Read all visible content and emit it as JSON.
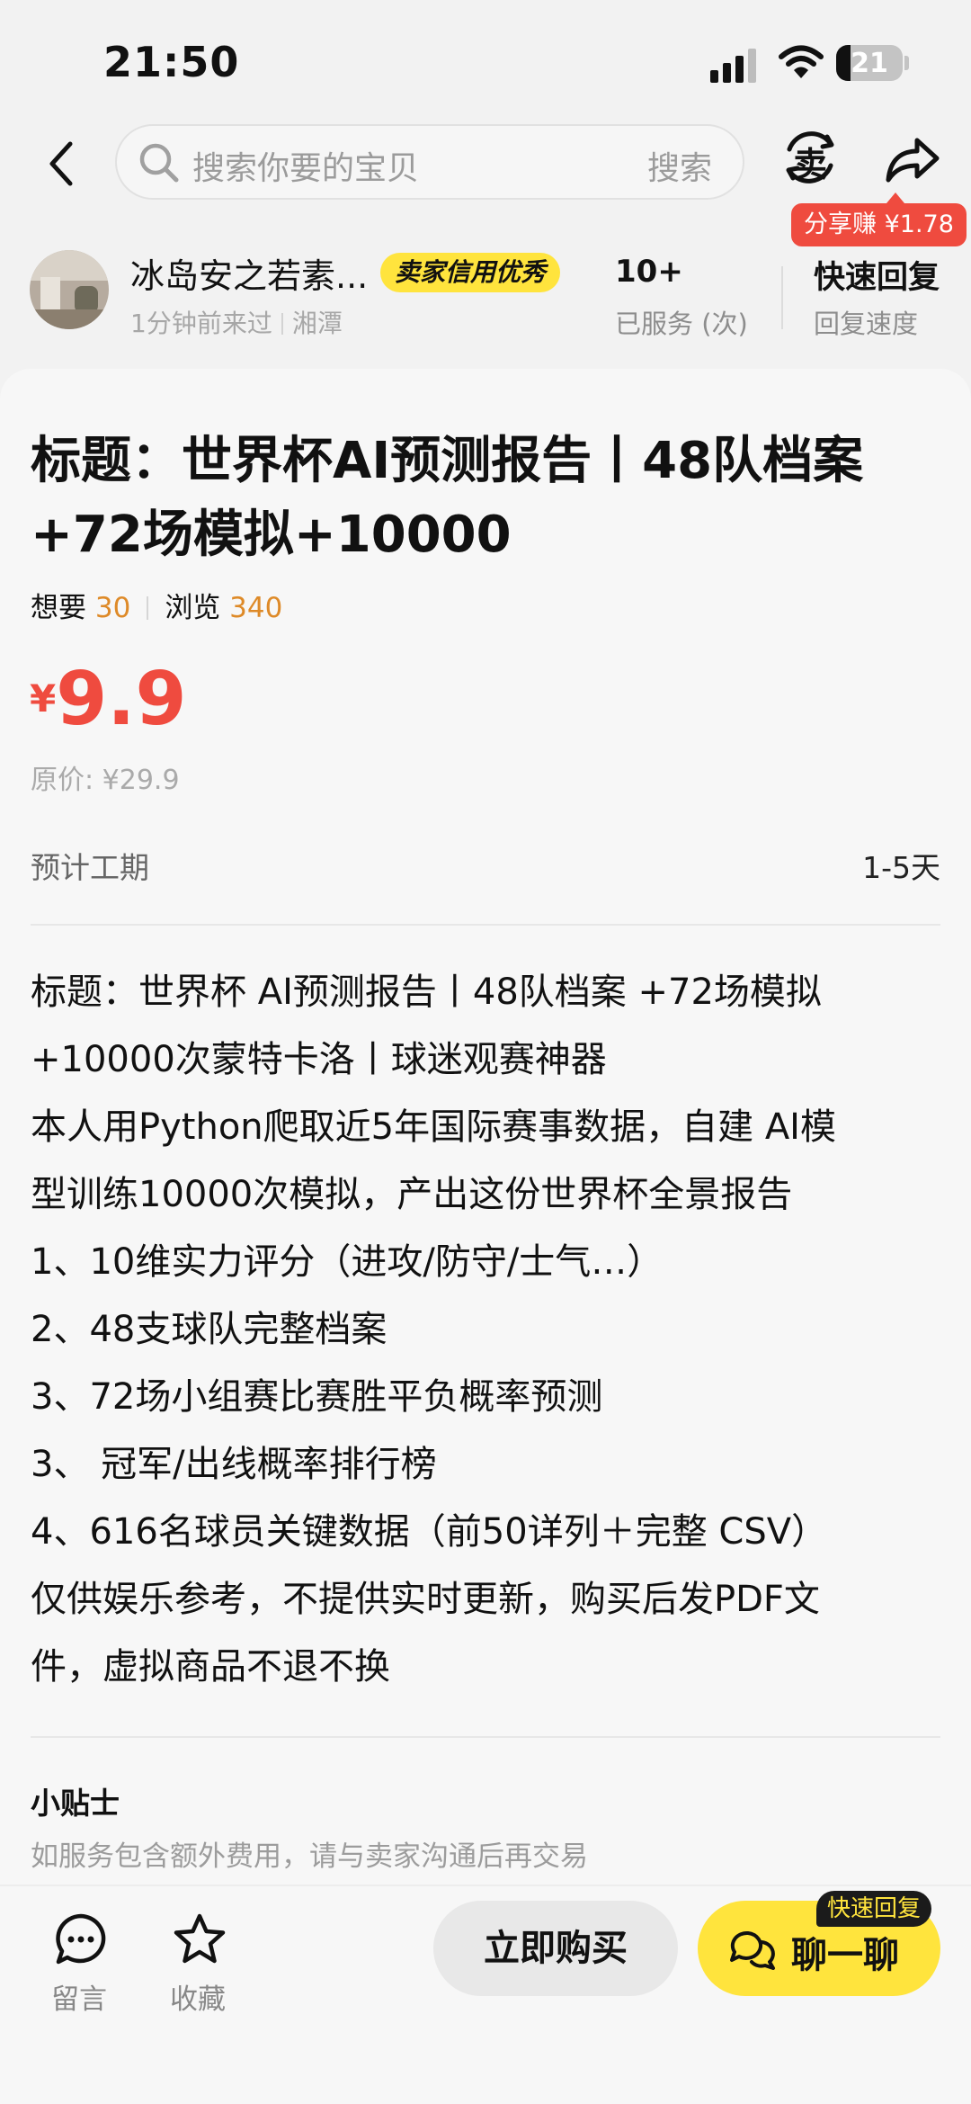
{
  "status_bar": {
    "time": "21:50",
    "battery": "21",
    "battery_level": 0.21
  },
  "search": {
    "placeholder": "搜索你要的宝贝",
    "button": "搜索"
  },
  "header": {
    "sell_icon_text": "卖",
    "share_badge": "分享赚 ¥1.78"
  },
  "seller": {
    "name": "冰岛安之若素...",
    "credit_badge": "卖家信用优秀",
    "last_visit": "1分钟前来过",
    "location": "湘潭",
    "served_value": "10+",
    "served_label": "已服务 (次)",
    "reply_value": "快速回复",
    "reply_label": "回复速度"
  },
  "listing": {
    "title": "标题：世界杯AI预测报告丨48队档案+72场模拟+10000",
    "want_label": "想要",
    "want_count": "30",
    "views_label": "浏览",
    "views_count": "340",
    "price_symbol": "¥",
    "price": "9.9",
    "original_price": "原价: ¥29.9",
    "period_label": "预计工期",
    "period_value": "1-5天",
    "description": [
      "标题：世界杯 AI预测报告丨48队档案 +72场模拟",
      " +10000次蒙特卡洛丨球迷观赛神器",
      "本人用Python爬取近5年国际赛事数据，自建 AI模",
      "型训练10000次模拟，产出这份世界杯全景报告",
      "1、10维实力评分（进攻/防守/士气…）",
      "2、48支球队完整档案",
      "3、72场小组赛比赛胜平负概率预测",
      "3、 冠军/出线概率排行榜",
      "4、616名球员关键数据（前50详列＋完整 CSV）",
      " 仅供娱乐参考，不提供实时更新，购买后发PDF文",
      "件，虚拟商品不退不换"
    ],
    "tips_title": "小贴士",
    "tips_text": "如服务包含额外费用，请与卖家沟通后再交易"
  },
  "bottom_bar": {
    "comment_label": "留言",
    "favorite_label": "收藏",
    "buy_label": "立即购买",
    "chat_label": "聊一聊",
    "quick_reply_badge": "快速回复"
  },
  "colors": {
    "accent_yellow": "#ffe43d",
    "price_red": "#ef4b3f",
    "count_orange": "#de8a28"
  }
}
